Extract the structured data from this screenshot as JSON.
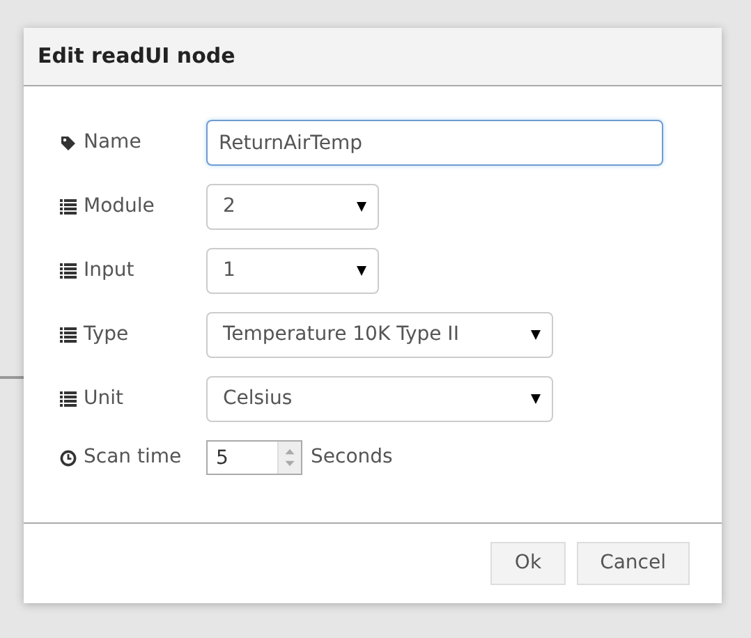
{
  "dialog": {
    "title": "Edit readUI node"
  },
  "fields": [
    {
      "kind": "text",
      "label": "Name",
      "value": "ReturnAirTemp",
      "focused": true
    },
    {
      "kind": "select",
      "label": "Module",
      "value": "2"
    },
    {
      "kind": "select",
      "label": "Input",
      "value": "1"
    },
    {
      "kind": "select",
      "label": "Type",
      "value": "Temperature 10K Type II"
    },
    {
      "kind": "select",
      "label": "Unit",
      "value": "Celsius"
    },
    {
      "kind": "spinner",
      "label": "Scan time",
      "value": "5",
      "suffix": "Seconds"
    }
  ],
  "buttons": [
    "Ok",
    "Cancel"
  ]
}
